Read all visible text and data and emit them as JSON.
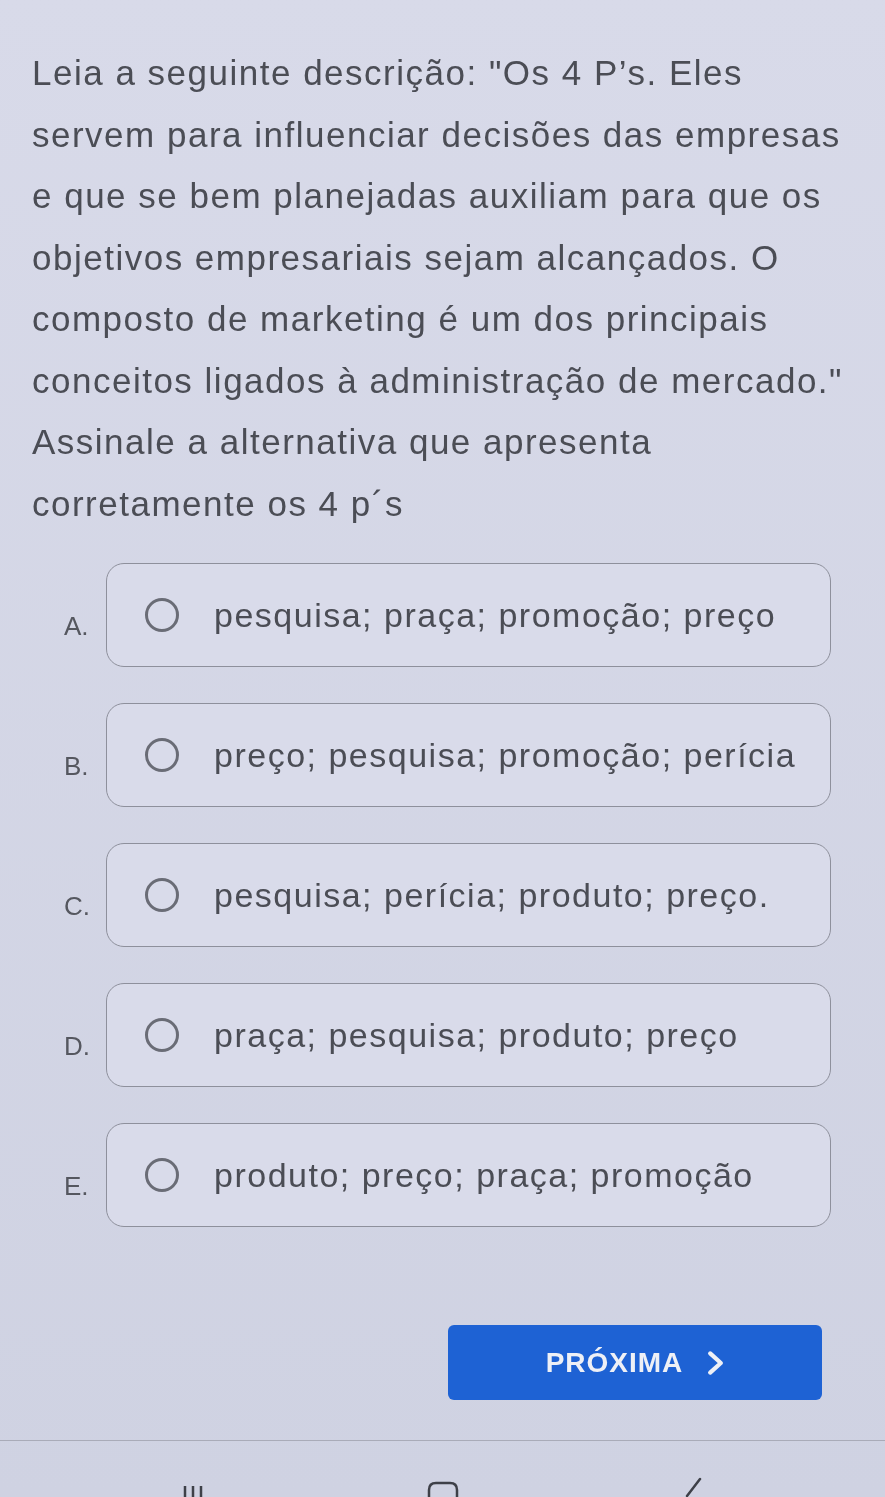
{
  "question": "Leia a seguinte descrição: \"Os 4 P’s. Eles servem para influenciar decisões das empresas e que se bem planejadas auxiliam para que os objetivos empresariais sejam alcançados. O composto de marketing é um dos principais conceitos ligados à administração de mercado.\" Assinale a alternativa que apresenta corretamente os 4 p´s",
  "options": [
    {
      "letter": "A.",
      "text": "pesquisa; praça; promoção; preço",
      "selected": false
    },
    {
      "letter": "B.",
      "text": "preço; pesquisa; promoção; perícia",
      "selected": false
    },
    {
      "letter": "C.",
      "text": "pesquisa; perícia; produto; preço.",
      "selected": false
    },
    {
      "letter": "D.",
      "text": "praça; pesquisa; produto; preço",
      "selected": false
    },
    {
      "letter": "E.",
      "text": "produto; preço; praça; promoção",
      "selected": false
    }
  ],
  "next_button": {
    "label": "PRÓXIMA"
  }
}
